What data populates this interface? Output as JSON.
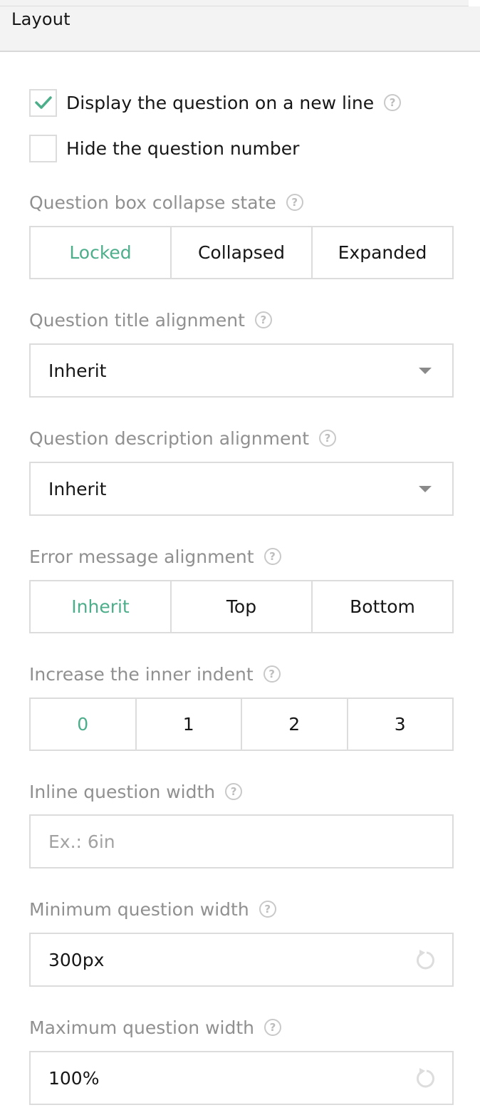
{
  "header": {
    "title": "Layout"
  },
  "checkboxes": [
    {
      "label": "Display the question on a new line",
      "checked": true,
      "has_help": true
    },
    {
      "label": "Hide the question number",
      "checked": false,
      "has_help": false
    }
  ],
  "collapse_state": {
    "label": "Question box collapse state",
    "options": [
      "Locked",
      "Collapsed",
      "Expanded"
    ],
    "selected": "Locked"
  },
  "title_alignment": {
    "label": "Question title alignment",
    "value": "Inherit"
  },
  "description_alignment": {
    "label": "Question description alignment",
    "value": "Inherit"
  },
  "error_alignment": {
    "label": "Error message alignment",
    "options": [
      "Inherit",
      "Top",
      "Bottom"
    ],
    "selected": "Inherit"
  },
  "inner_indent": {
    "label": "Increase the inner indent",
    "options": [
      "0",
      "1",
      "2",
      "3"
    ],
    "selected": "0"
  },
  "inline_width": {
    "label": "Inline question width",
    "value": "",
    "placeholder": "Ex.: 6in"
  },
  "min_width": {
    "label": "Minimum question width",
    "value": "300px"
  },
  "max_width": {
    "label": "Maximum question width",
    "value": "100%"
  },
  "icons": {
    "help": "?",
    "check_color": "#4cae8b",
    "accent": "#4cae8b"
  }
}
